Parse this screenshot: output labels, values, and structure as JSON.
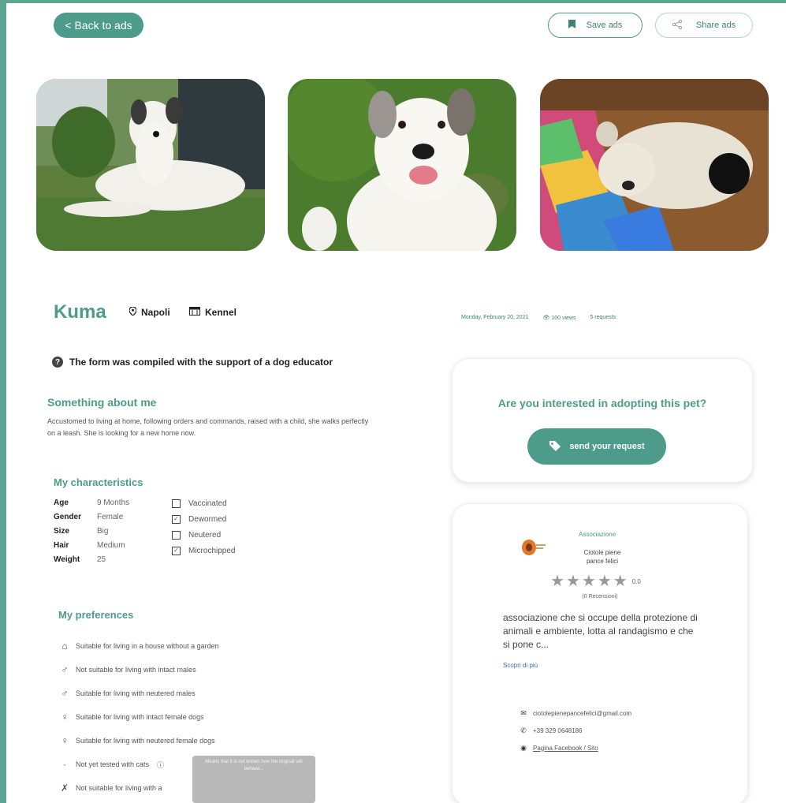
{
  "colors": {
    "accent": "#4d9c8b",
    "frame": "#5fa596",
    "link": "#3d6fb0"
  },
  "header": {
    "back_label": "< Back to ads",
    "save_label": "Save ads",
    "share_label": "Share ads"
  },
  "photos": [
    "photo-dog-lying-on-grass",
    "photo-dog-smiling-on-grass",
    "photo-dog-curled-on-floor"
  ],
  "pet": {
    "name": "Kuma",
    "city": "Napoli",
    "type": "Kennel",
    "date": "Monday, February 20, 2021",
    "views": "100 views",
    "requests": "5 requests"
  },
  "educator_note": "The form was compiled with the support of a dog educator",
  "about": {
    "title": "Something about me",
    "text": "Accustomed to living at home, following orders and commands, raised with a child, she walks perfectly on a leash. She is looking for a new home now."
  },
  "characteristics": {
    "title": "My characteristics",
    "rows": [
      {
        "key": "Age",
        "value": "9 Months"
      },
      {
        "key": "Gender",
        "value": "Female"
      },
      {
        "key": "Size",
        "value": "Big"
      },
      {
        "key": "Hair",
        "value": "Medium"
      },
      {
        "key": "Weight",
        "value": "25"
      }
    ],
    "checks": [
      {
        "label": "Vaccinated",
        "checked": false
      },
      {
        "label": "Dewormed",
        "checked": true
      },
      {
        "label": "Neutered",
        "checked": false
      },
      {
        "label": "Microchipped",
        "checked": true
      }
    ]
  },
  "preferences": {
    "title": "My preferences",
    "items": [
      {
        "icon": "house-icon",
        "label": "Suitable for living in a house without a garden"
      },
      {
        "icon": "male-dog-icon",
        "label": "Not suitable for living with intact males"
      },
      {
        "icon": "male-dog-icon",
        "label": "Suitable for living with neutered males"
      },
      {
        "icon": "female-dog-icon",
        "label": "Suitable for living with intact female dogs"
      },
      {
        "icon": "female-dog-icon",
        "label": "Suitable for living with neutered female dogs"
      },
      {
        "icon": "cat-icon",
        "label": "Not yet tested with cats"
      },
      {
        "icon": "child-icon",
        "label": "Not suitable for living with a"
      }
    ],
    "tooltip": "Means that it is not known how the dog/cat will behave..."
  },
  "adopt": {
    "question": "Are you interested in adopting this pet?",
    "button_label": "send your request"
  },
  "association": {
    "type": "Associazione",
    "name": "Ciotole piene pance felici",
    "rating": "0.0",
    "reviews": "(0 Recensioni)",
    "description": "associazione che si occupe della protezione di animali e ambiente, lotta al randagismo e che si pone c...",
    "more_label": "Scopri di più",
    "email": "ciotolepienepancefelici@gmail.com",
    "phone": "+39 329 0648186",
    "links_label": "Pagina Facebook / Sito"
  }
}
